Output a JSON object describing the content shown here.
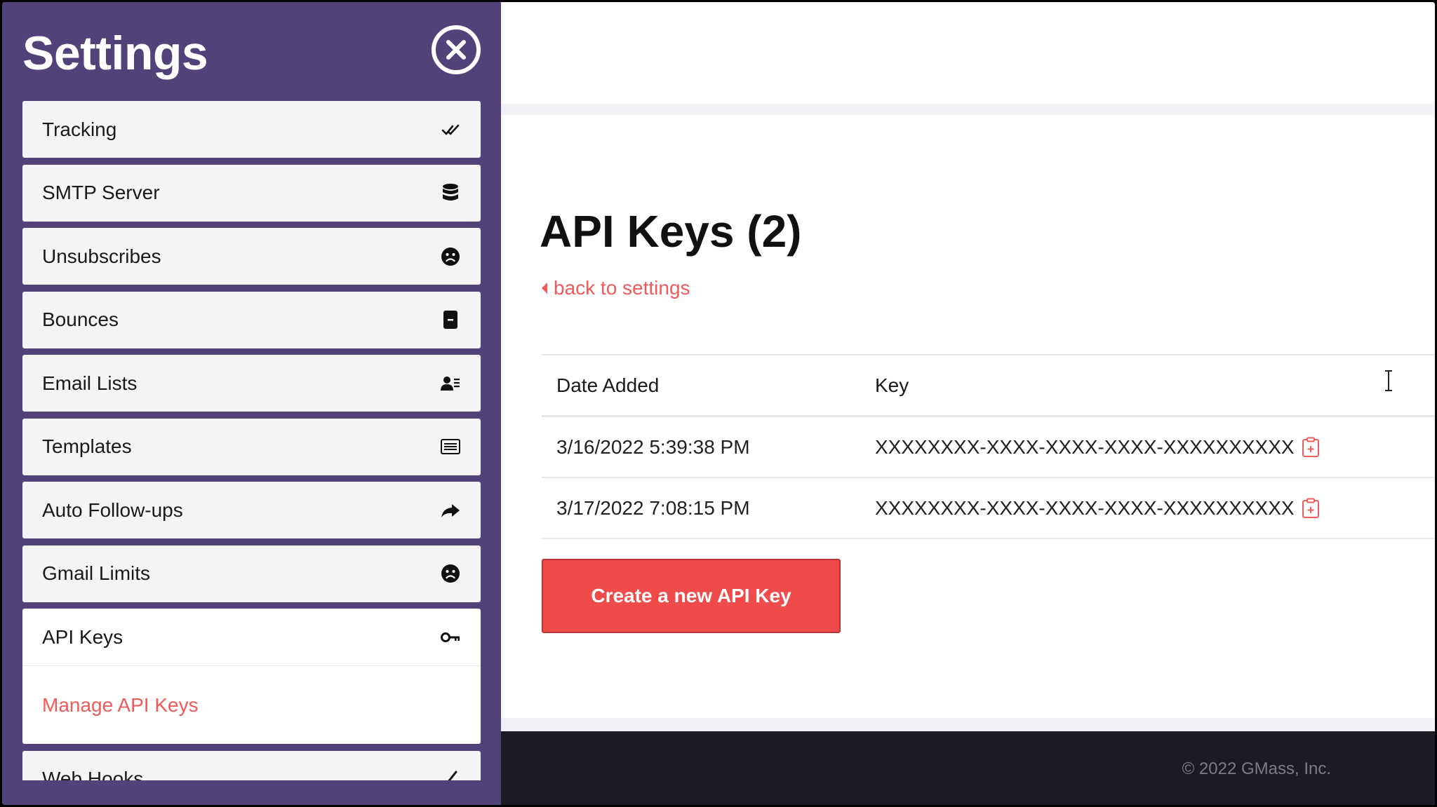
{
  "sidebar": {
    "title": "Settings",
    "close_icon": "close-circle-icon",
    "items": [
      {
        "label": "Tracking",
        "icon": "double-check-icon"
      },
      {
        "label": "SMTP Server",
        "icon": "database-icon"
      },
      {
        "label": "Unsubscribes",
        "icon": "sad-face-icon"
      },
      {
        "label": "Bounces",
        "icon": "bounce-doc-icon"
      },
      {
        "label": "Email Lists",
        "icon": "user-list-icon"
      },
      {
        "label": "Templates",
        "icon": "list-box-icon"
      },
      {
        "label": "Auto Follow-ups",
        "icon": "share-arrow-icon"
      },
      {
        "label": "Gmail Limits",
        "icon": "sad-face-icon"
      },
      {
        "label": "API Keys",
        "icon": "key-icon",
        "active": true,
        "subitem": "Manage API Keys"
      },
      {
        "label": "Web Hooks",
        "icon": "webhook-icon"
      }
    ]
  },
  "main": {
    "title": "API Keys (2)",
    "back_link": "back to settings",
    "table": {
      "headers": {
        "date": "Date Added",
        "key": "Key"
      },
      "rows": [
        {
          "date": "3/16/2022 5:39:38 PM",
          "key": "XXXXXXXX-XXXX-XXXX-XXXX-XXXXXXXXXX"
        },
        {
          "date": "3/17/2022 7:08:15 PM",
          "key": "XXXXXXXX-XXXX-XXXX-XXXX-XXXXXXXXXX"
        }
      ]
    },
    "create_button": "Create a new API Key",
    "footer": "© 2022 GMass, Inc."
  },
  "colors": {
    "sidebar_bg": "#52427a",
    "accent_red": "#ef4b4b",
    "link_red": "#ef5a5a",
    "footer_bg": "#1b1b24"
  }
}
